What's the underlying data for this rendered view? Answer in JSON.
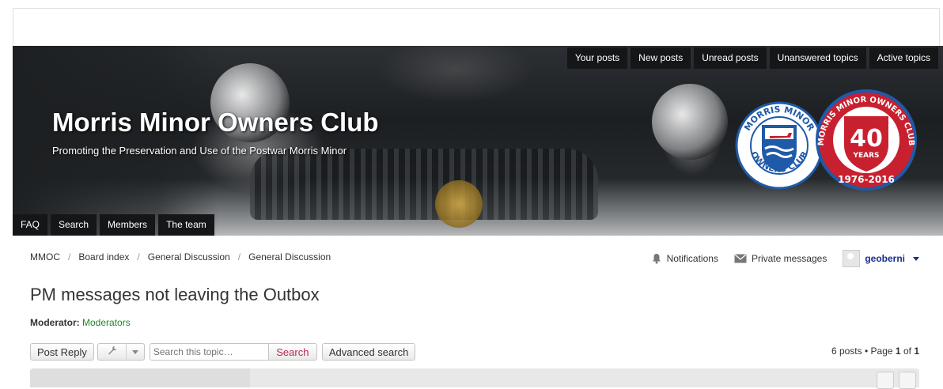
{
  "header": {
    "site_title": "Morris Minor Owners Club",
    "site_description": "Promoting the Preservation and Use of the Postwar Morris Minor",
    "top_nav": [
      "Your posts",
      "New posts",
      "Unread posts",
      "Unanswered topics",
      "Active topics"
    ],
    "bottom_nav": [
      "FAQ",
      "Search",
      "Members",
      "The team"
    ],
    "logo_left": {
      "top_text": "MORRIS MINOR",
      "bottom_text": "OWNERS CLUB"
    },
    "logo_right": {
      "ring_text": "MORRIS MINOR OWNERS CLUB",
      "number": "40",
      "unit": "YEARS",
      "range": "1976-2016"
    }
  },
  "breadcrumbs": [
    "MMOC",
    "Board index",
    "General Discussion",
    "General Discussion"
  ],
  "user_bar": {
    "notifications": "Notifications",
    "private_messages": "Private messages",
    "username": "geoberni"
  },
  "topic": {
    "title": "PM messages not leaving the Outbox",
    "moderator_label": "Moderator:",
    "moderator_value": "Moderators"
  },
  "actions": {
    "post_reply": "Post Reply",
    "search_placeholder": "Search this topic…",
    "search_button": "Search",
    "advanced_search": "Advanced search"
  },
  "pagination": {
    "posts": "6 posts",
    "page_word": "Page",
    "current": "1",
    "of_word": "of",
    "total": "1"
  },
  "colors": {
    "nav_bg": "#141618",
    "username": "#1a2d8a",
    "moderator_link": "#1f8a1f",
    "search_button_text": "#bc2a4d",
    "logo_blue": "#1f5aa8",
    "logo_red": "#c8202f"
  }
}
